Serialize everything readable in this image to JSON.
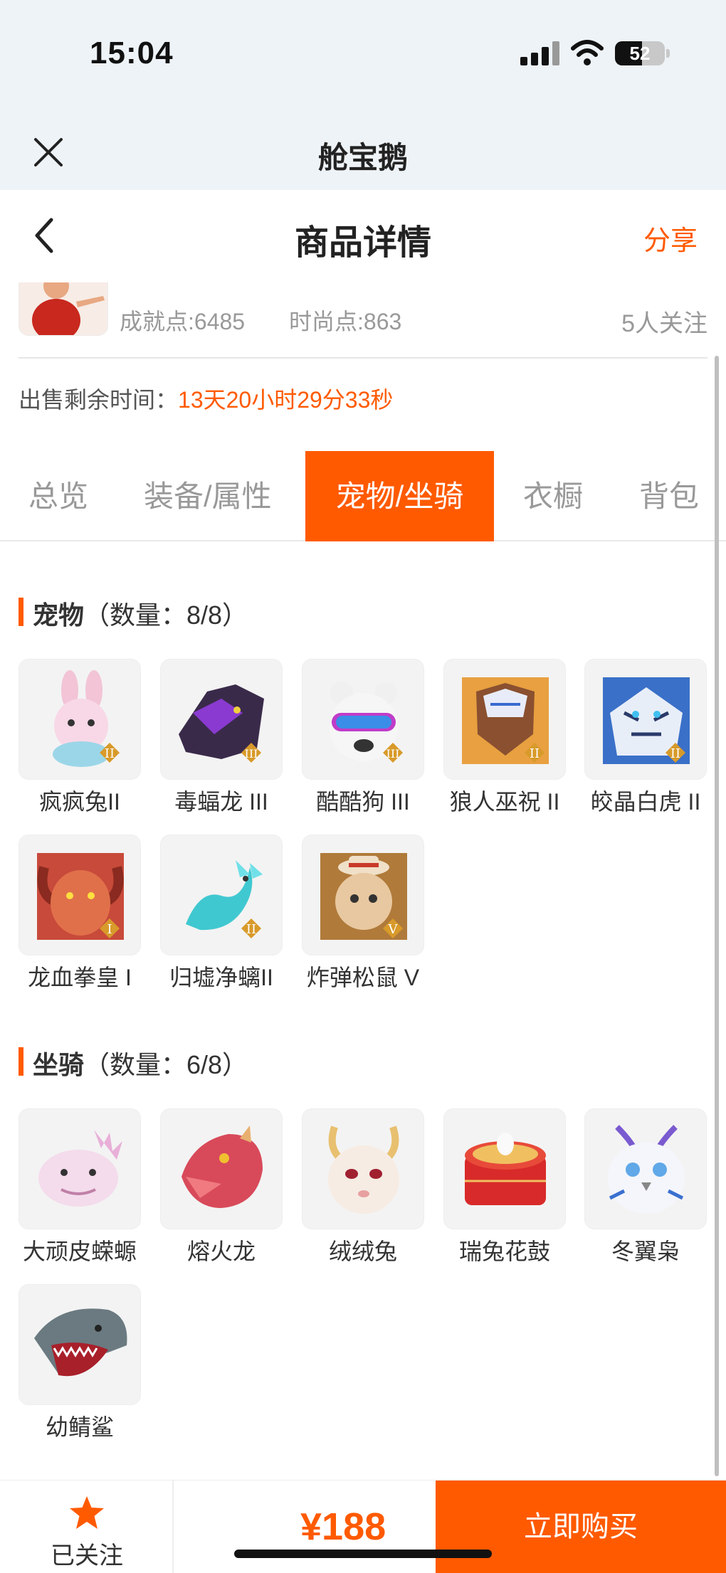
{
  "status": {
    "time": "15:04",
    "battery": "52"
  },
  "app": {
    "title": "舱宝鹅"
  },
  "nav": {
    "title": "商品详情",
    "share": "分享"
  },
  "item": {
    "stat_achievement": "成就点:6485",
    "stat_fashion": "时尚点:863",
    "followers": "5人关注"
  },
  "sale": {
    "label": "出售剩余时间：",
    "value": "13天20小时29分33秒"
  },
  "tabs": [
    "总览",
    "装备/属性",
    "宠物/坐骑",
    "衣橱",
    "背包"
  ],
  "active_tab": "宠物/坐骑",
  "pets": {
    "title": "宠物",
    "count": "（数量：8/8）",
    "items": [
      "疯疯兔II",
      "毒蝠龙 III",
      "酷酷狗 III",
      "狼人巫祝 II",
      "皎晶白虎 II",
      "龙血拳皇 I",
      "归墟净螭II",
      "炸弹松鼠 V"
    ]
  },
  "mounts": {
    "title": "坐骑",
    "count": "（数量：6/8）",
    "items": [
      "大顽皮蝾螈",
      "熔火龙",
      "绒绒兔",
      "瑞兔花鼓",
      "冬翼枭",
      "幼鲭鲨"
    ]
  },
  "bottom": {
    "follow_label": "已关注",
    "price": "¥188",
    "buy_label": "立即购买"
  },
  "colors": {
    "accent": "#ff5a00",
    "statusbar_bg": "#eef3f7"
  },
  "icons": [
    "close-icon",
    "back-icon",
    "star-icon",
    "signal-icon",
    "wifi-icon",
    "battery-icon"
  ]
}
